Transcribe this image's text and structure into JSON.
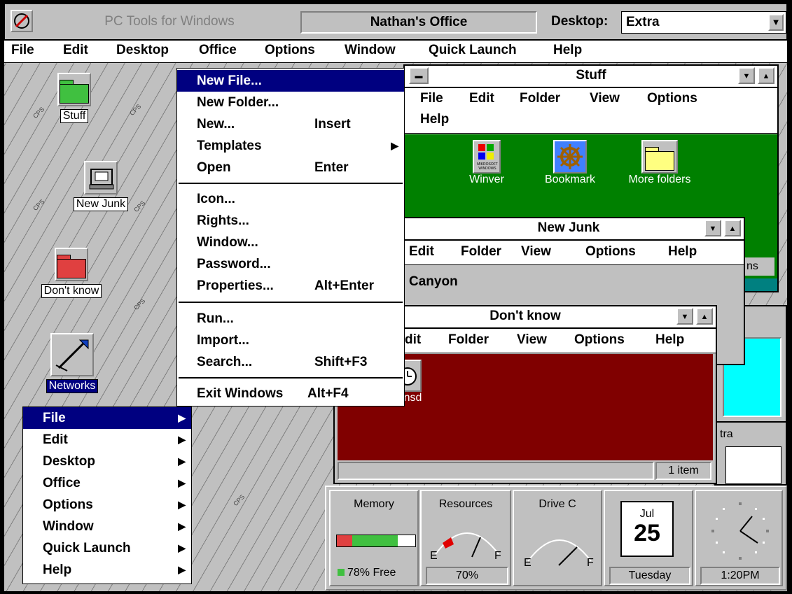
{
  "titlebar": {
    "app_title": "PC Tools for Windows",
    "office_name": "Nathan's Office",
    "desktop_label": "Desktop:",
    "desktop_value": "Extra"
  },
  "menubar": [
    "File",
    "Edit",
    "Desktop",
    "Office",
    "Options",
    "Window",
    "Quick Launch",
    "Help"
  ],
  "desktop_icons": {
    "stuff": "Stuff",
    "new_junk": "New Junk",
    "dont_know": "Don't know",
    "networks": "Networks"
  },
  "watermark": "CPS",
  "windows": {
    "stuff": {
      "title": "Stuff",
      "menu": [
        "File",
        "Edit",
        "Folder",
        "View",
        "Options",
        "Help"
      ],
      "items": [
        "Winver",
        "Bookmark",
        "More folders"
      ],
      "winver_icon_text": "MIKROSOFT WINDOWS",
      "side_text": "ns"
    },
    "new_junk": {
      "title": "New Junk",
      "menu": [
        "Edit",
        "Folder",
        "View",
        "Options",
        "Help"
      ],
      "item": "Canyon"
    },
    "dont_know": {
      "title": "Don't know",
      "menu": [
        "dit",
        "Folder",
        "View",
        "Options",
        "Help"
      ],
      "item": "Wnsd",
      "status": "1 item"
    },
    "back": {
      "label1": "ns",
      "label2": "tra"
    }
  },
  "file_menu": {
    "items": [
      {
        "label": "New File...",
        "accel": "",
        "selected": true
      },
      {
        "label": "New Folder...",
        "accel": ""
      },
      {
        "label": "New...",
        "accel": "Insert"
      },
      {
        "label": "Templates",
        "accel": "",
        "submenu": true
      },
      {
        "label": "Open",
        "accel": "Enter"
      },
      {
        "label": "Icon...",
        "accel": ""
      },
      {
        "label": "Rights...",
        "accel": ""
      },
      {
        "label": "Window...",
        "accel": ""
      },
      {
        "label": "Password...",
        "accel": ""
      },
      {
        "label": "Properties...",
        "accel": "Alt+Enter"
      },
      {
        "label": "Run...",
        "accel": ""
      },
      {
        "label": "Import...",
        "accel": ""
      },
      {
        "label": "Search...",
        "accel": "Shift+F3"
      },
      {
        "label": "Exit Windows",
        "accel": "Alt+F4"
      }
    ]
  },
  "popup_menu": [
    "File",
    "Edit",
    "Desktop",
    "Office",
    "Options",
    "Window",
    "Quick Launch",
    "Help"
  ],
  "gauges": {
    "memory_label": "Memory",
    "memory_value": "78% Free",
    "memory_free_fraction": 0.78,
    "resources_label": "Resources",
    "resources_value": "70%",
    "drive_label": "Drive C",
    "gauge_e": "E",
    "gauge_f": "F",
    "month": "Jul",
    "day": "25",
    "weekday": "Tuesday",
    "time": "1:20PM"
  }
}
